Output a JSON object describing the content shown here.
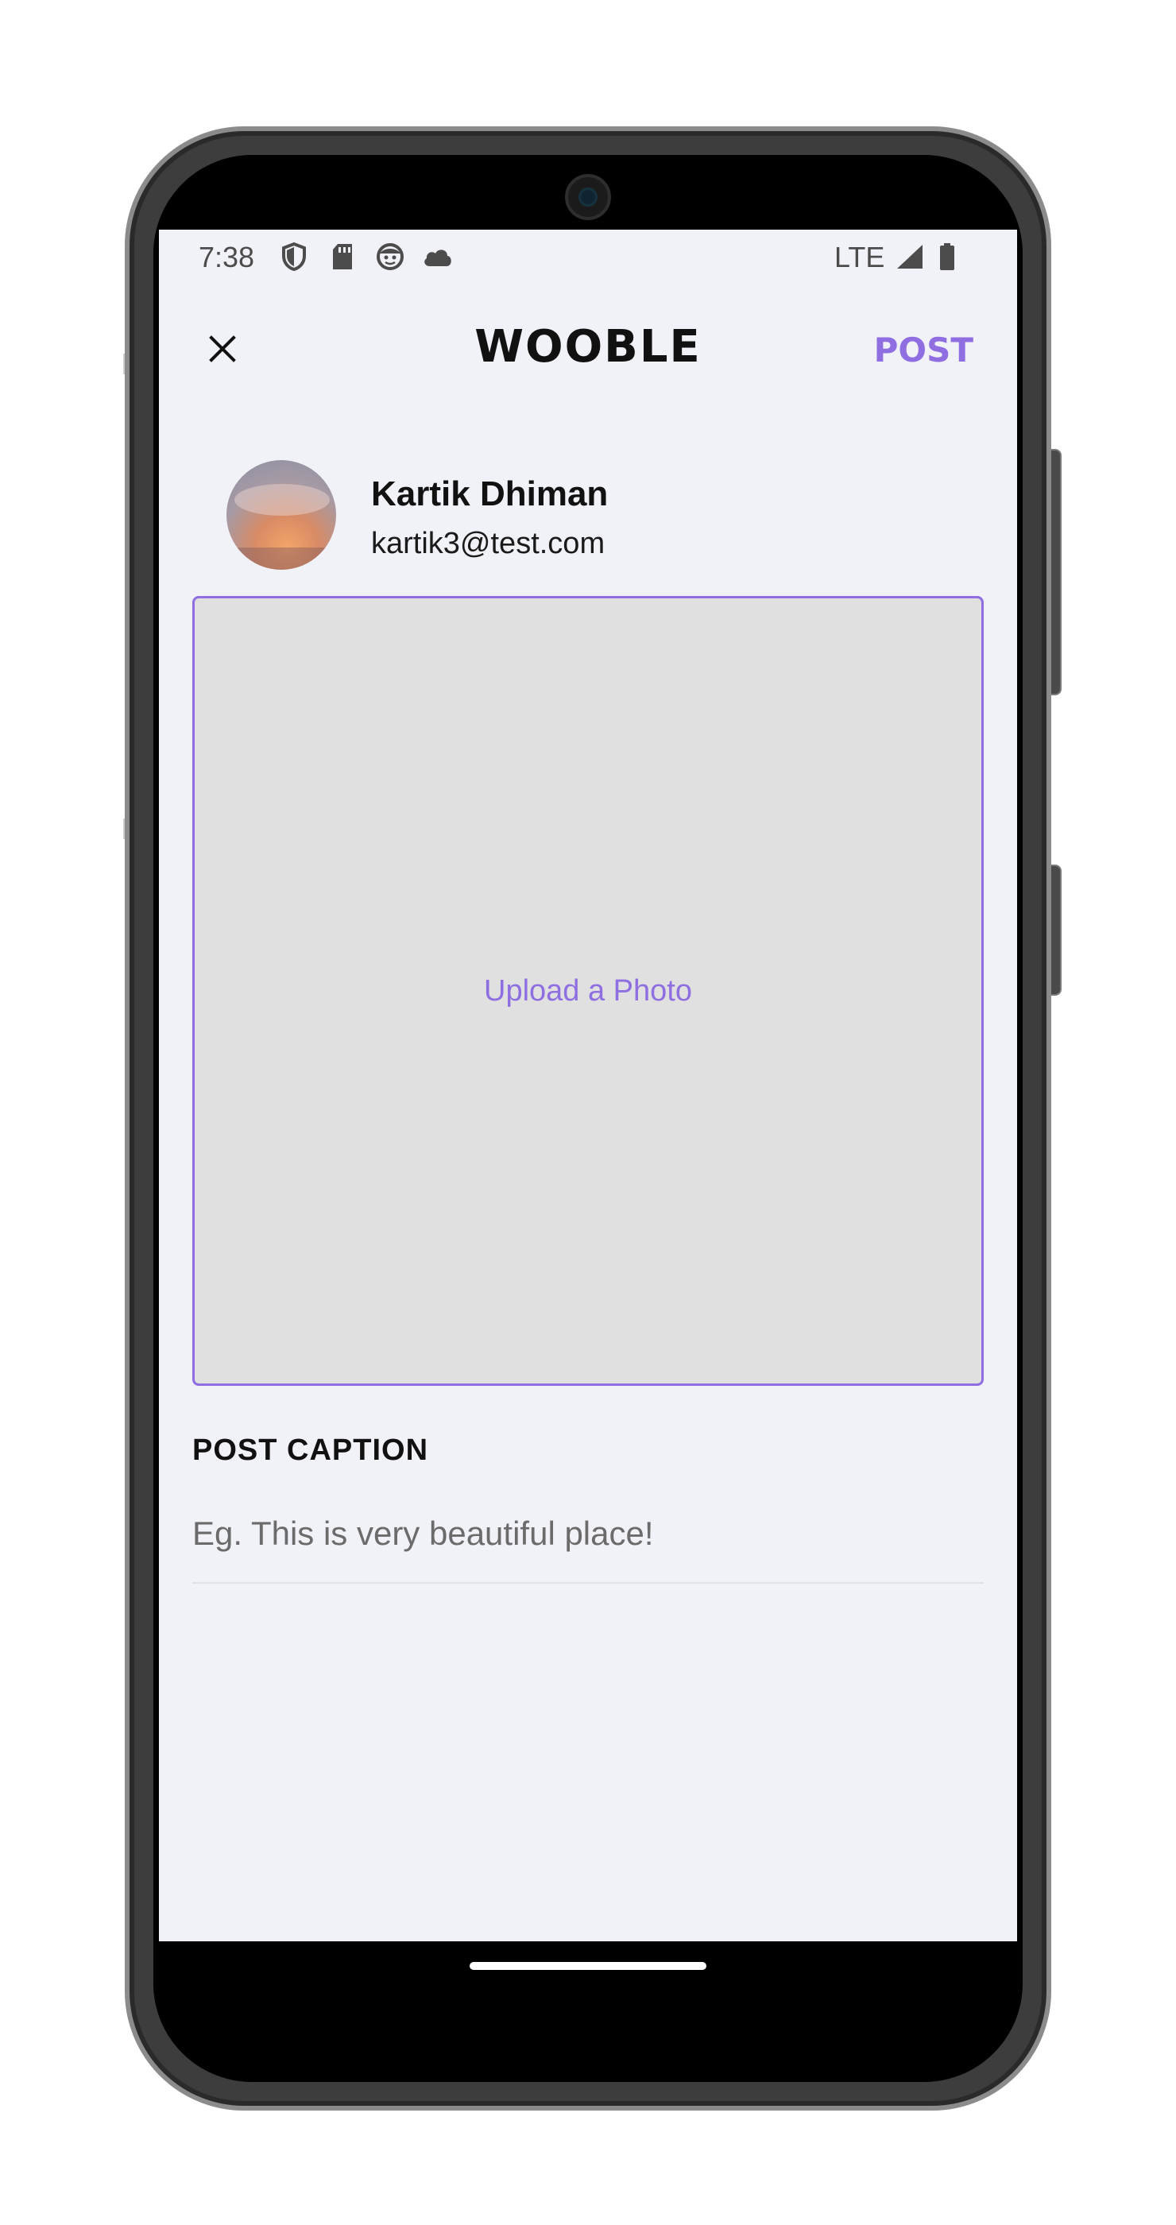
{
  "status_bar": {
    "time": "7:38",
    "network": "LTE",
    "icons": [
      "shield-icon",
      "sd-card-icon",
      "face-icon",
      "cloud-icon",
      "signal-icon",
      "battery-icon"
    ]
  },
  "app_bar": {
    "title": "WOOBLE",
    "post_label": "POST",
    "close_icon": "close-icon"
  },
  "profile": {
    "name": "Kartik Dhiman",
    "email": "kartik3@test.com"
  },
  "upload": {
    "label": "Upload a Photo"
  },
  "caption": {
    "label": "POST CAPTION",
    "placeholder": "Eg. This is very beautiful place!",
    "value": ""
  },
  "colors": {
    "accent": "#8e6ee0",
    "screen_bg": "#f1f2f8",
    "upload_bg": "#e0e0e0"
  }
}
